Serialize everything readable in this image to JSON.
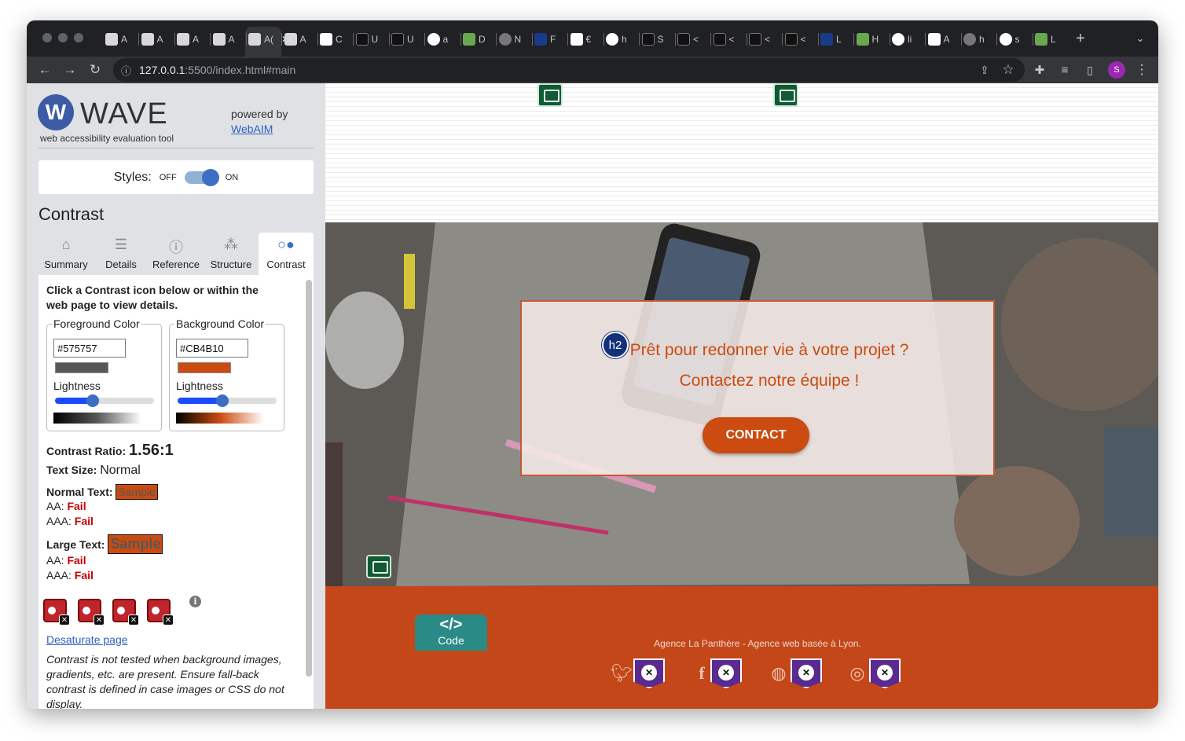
{
  "browser": {
    "url_host": "127.0.0.1",
    "url_rest": ":5500/index.html#main",
    "profile_initial": "S",
    "tabs": [
      {
        "letter": "A",
        "icon": "gray"
      },
      {
        "letter": "A",
        "icon": "gray"
      },
      {
        "letter": "A",
        "icon": "gray"
      },
      {
        "letter": "A",
        "icon": "gray"
      },
      {
        "letter": "A(",
        "icon": "active"
      },
      {
        "letter": "A",
        "icon": "gray"
      },
      {
        "letter": "C",
        "icon": "white"
      },
      {
        "letter": "U",
        "icon": "dark"
      },
      {
        "letter": "U",
        "icon": "dark"
      },
      {
        "letter": "a",
        "icon": "g"
      },
      {
        "letter": "D",
        "icon": "green"
      },
      {
        "letter": "N",
        "icon": "globe"
      },
      {
        "letter": "F",
        "icon": "blue"
      },
      {
        "letter": "€",
        "icon": "white"
      },
      {
        "letter": "h",
        "icon": "g"
      },
      {
        "letter": "S",
        "icon": "dark"
      },
      {
        "letter": "<",
        "icon": "dark"
      },
      {
        "letter": "<",
        "icon": "dark"
      },
      {
        "letter": "<",
        "icon": "dark"
      },
      {
        "letter": "<",
        "icon": "dark"
      },
      {
        "letter": "L",
        "icon": "blue"
      },
      {
        "letter": "H",
        "icon": "green"
      },
      {
        "letter": "li",
        "icon": "g"
      },
      {
        "letter": "A",
        "icon": "white"
      },
      {
        "letter": "h",
        "icon": "globe"
      },
      {
        "letter": "s",
        "icon": "g"
      },
      {
        "letter": "L",
        "icon": "green"
      }
    ]
  },
  "wave": {
    "logo_letter": "W",
    "title": "WAVE",
    "subtitle": "web accessibility evaluation tool",
    "powered_by": "powered by",
    "webaim_link": "WebAIM",
    "styles_label": "Styles:",
    "styles_off": "OFF",
    "styles_on": "ON",
    "panel_title": "Contrast",
    "tabs": [
      {
        "label": "Summary",
        "icon": "home-icon"
      },
      {
        "label": "Details",
        "icon": "list-icon"
      },
      {
        "label": "Reference",
        "icon": "info-icon"
      },
      {
        "label": "Structure",
        "icon": "structure-icon"
      },
      {
        "label": "Contrast",
        "icon": "contrast-icon"
      }
    ],
    "intro": "Click a Contrast icon below or within the web page to view details.",
    "foreground": {
      "legend": "Foreground Color",
      "value": "#575757",
      "lightness_label": "Lightness",
      "lightness": 0.38
    },
    "background": {
      "legend": "Background Color",
      "value": "#CB4B10",
      "lightness_label": "Lightness",
      "lightness": 0.45
    },
    "ratio_label": "Contrast Ratio:",
    "ratio_value": "1.56:1",
    "text_size_label": "Text Size:",
    "text_size_value": "Normal",
    "normal_text_label": "Normal Text:",
    "large_text_label": "Large Text:",
    "sample": "Sample",
    "aa_label": "AA:",
    "aaa_label": "AAA:",
    "fail": "Fail",
    "contrast_icon_count": 4,
    "desaturate_link": "Desaturate page",
    "note": "Contrast is not tested when background images, gradients, etc. are present. Ensure fall-back contrast is defined in case images or CSS do not display."
  },
  "page": {
    "h2_badge": "h2",
    "cta_heading_line1": "Prêt pour redonner vie à votre projet ?",
    "cta_heading_line2": "Contactez notre équipe !",
    "contact_button": "CONTACT",
    "footer_text": "Agence La Panthère - Agence web basée à Lyon.",
    "social": [
      "twitter-icon",
      "facebook-icon",
      "dribbble-icon",
      "instagram-icon"
    ],
    "code_button_symbol": "</>",
    "code_button_label": "Code"
  },
  "colors": {
    "foreground": "#575757",
    "background": "#CB4B10",
    "wave_blue": "#3c6fc4",
    "fail_red": "#cc0000"
  }
}
